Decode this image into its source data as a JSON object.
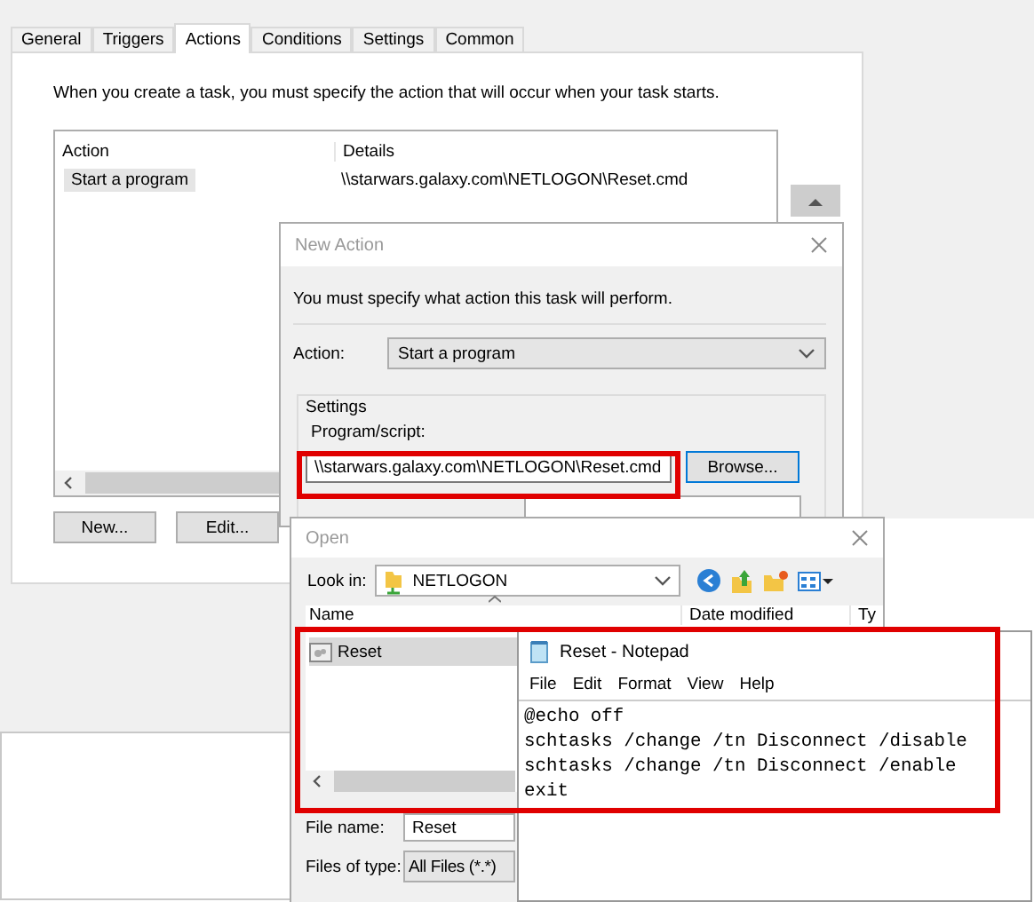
{
  "task_window": {
    "tabs": [
      {
        "label": "General",
        "selected": false
      },
      {
        "label": "Triggers",
        "selected": false
      },
      {
        "label": "Actions",
        "selected": true
      },
      {
        "label": "Conditions",
        "selected": false
      },
      {
        "label": "Settings",
        "selected": false
      },
      {
        "label": "Common",
        "selected": false
      }
    ],
    "description": "When you create a task, you must specify the action that will occur when your task starts.",
    "columns": [
      "Action",
      "Details"
    ],
    "rows": [
      {
        "action": "Start a program",
        "details": "\\\\starwars.galaxy.com\\NETLOGON\\Reset.cmd",
        "selected": true
      }
    ],
    "buttons": [
      "New...",
      "Edit..."
    ]
  },
  "new_action": {
    "title": "New Action",
    "instruction": "You must specify what action this task will perform.",
    "action_label": "Action:",
    "action_value": "Start a program",
    "settings_label": "Settings",
    "program_label": "Program/script:",
    "program_value": "\\\\starwars.galaxy.com\\NETLOGON\\Reset.cmd",
    "browse_button": "Browse..."
  },
  "open_dialog": {
    "title": "Open",
    "look_in_label": "Look in:",
    "look_in_value": "NETLOGON",
    "columns": [
      "Name",
      "Date modified",
      "Ty"
    ],
    "files": [
      {
        "name": "Reset",
        "selected": true
      }
    ],
    "file_name_label": "File name:",
    "file_name_value": "Reset",
    "file_type_label": "Files of type:",
    "file_type_value": "All Files (*.*)"
  },
  "notepad": {
    "title": "Reset - Notepad",
    "menu": [
      "File",
      "Edit",
      "Format",
      "View",
      "Help"
    ],
    "lines": [
      "@echo off",
      "schtasks /change /tn Disconnect /disable",
      "schtasks /change /tn Disconnect /enable",
      "exit"
    ]
  }
}
